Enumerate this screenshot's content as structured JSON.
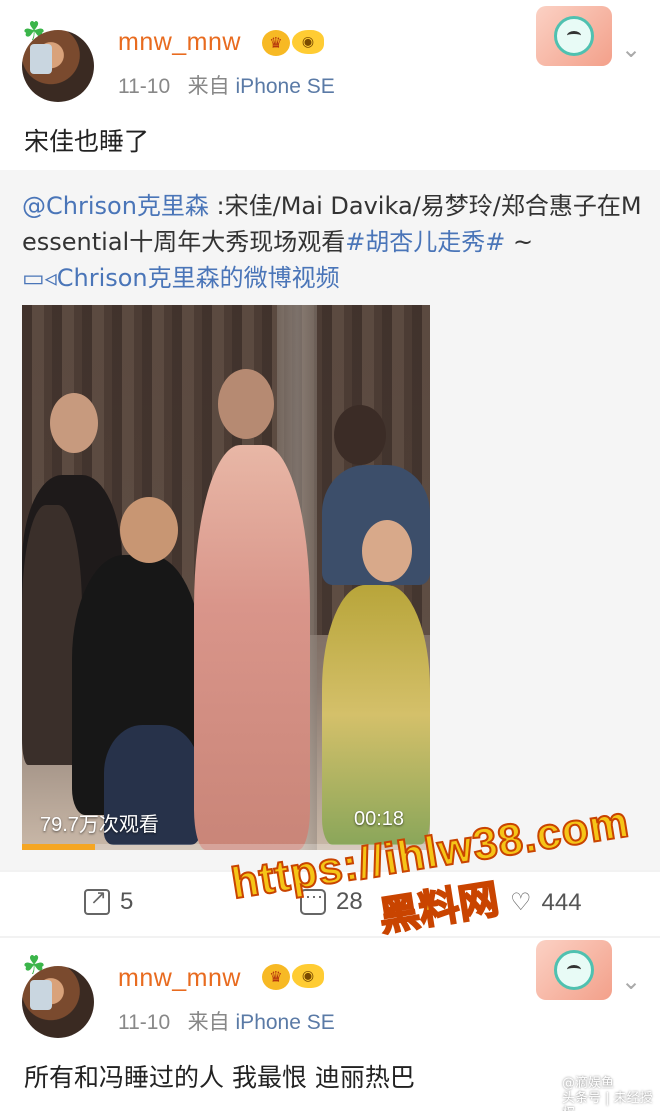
{
  "post1": {
    "username": "mnw_mnw",
    "date": "11-10",
    "source_prefix": "来自",
    "source_device": "iPhone SE",
    "text": "宋佳也睡了",
    "repost": {
      "author": "@Chrison克里森",
      "text": " :宋佳/Mai Davika/易梦玲/郑合惠子在M essential十周年大秀现场观看",
      "hashtag": "#胡杏儿走秀#",
      "tail": " ~",
      "video_link": "Chrison克里森的微博视频",
      "video": {
        "views": "79.7万次观看",
        "duration": "00:18",
        "progress": 0.18
      }
    },
    "actions": {
      "share_count": "5",
      "comment_count": "28",
      "like_count": "444"
    }
  },
  "watermark": {
    "url": "https://ihlw38.com",
    "site": "黑料网"
  },
  "post2": {
    "username": "mnw_mnw",
    "date": "11-10",
    "source_prefix": "来自",
    "source_device": "iPhone SE",
    "text": "所有和冯睡过的人 我最恨 迪丽热巴"
  },
  "corner_mark": {
    "line1": "@滴娱鱼",
    "line2": "头条号 | 未经授权"
  },
  "icons": {
    "badge_crown": "crown-badge-icon",
    "badge_fish": "fish-badge-icon",
    "more": "chevron-down-icon",
    "share": "share-icon",
    "comment": "comment-icon",
    "like": "like-icon",
    "video_link": "video-camera-icon"
  }
}
